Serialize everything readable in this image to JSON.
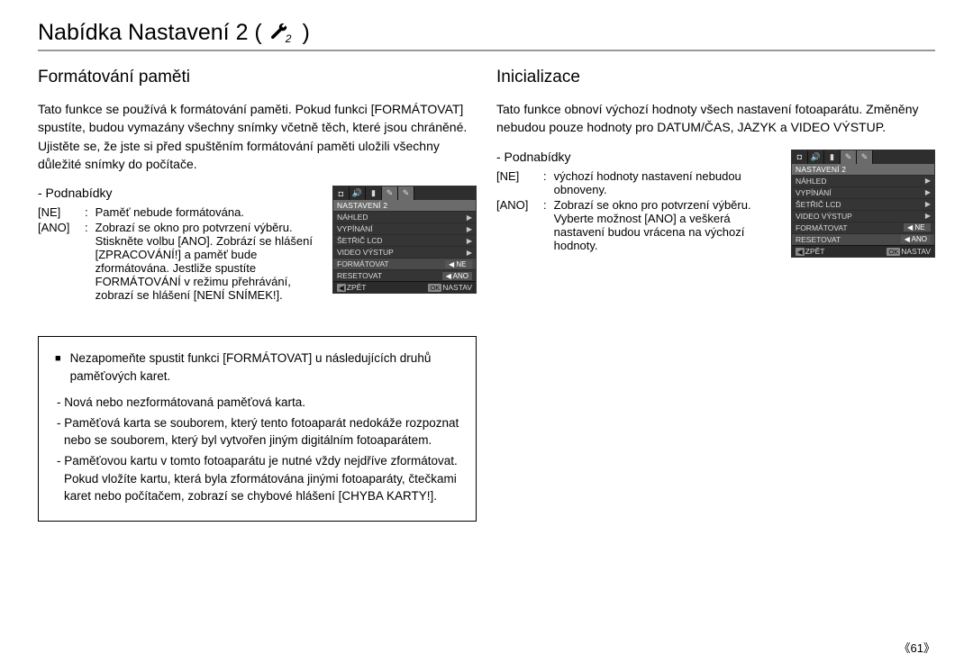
{
  "title_prefix": "Nabídka Nastavení 2 (",
  "title_suffix": ")",
  "col_left": {
    "heading": "Formátování paměti",
    "intro": "Tato funkce se používá k formátování paměti. Pokud funkci [FORMÁTOVAT] spustíte, budou vymazány všechny snímky včetně těch, které jsou chráněné. Ujistěte se, že jste si před spuštěním formátování paměti uložili všechny důležité snímky do počítače.",
    "sub_label": "- Podnabídky",
    "opts": [
      {
        "key": "[NE]",
        "sep": ":",
        "desc": "Paměť nebude formátována."
      },
      {
        "key": "[ANO]",
        "sep": ":",
        "desc": "Zobrazí se okno pro potvrzení výběru. Stiskněte volbu [ANO]. Zobrází se hlášení [ZPRACOVÁNÍ!] a paměť bude zformátována. Jestliže spustíte FORMÁTOVÁNÍ v režimu přehrávání, zobrazí se hlášení [NENÍ SNÍMEK!]."
      }
    ],
    "note_lead": "Nezapomeňte spustit funkci [FORMÁTOVAT] u následujících druhů paměťových karet.",
    "note_items": [
      "- Nová nebo nezformátovaná paměťová karta.",
      "- Paměťová karta se souborem, který tento fotoaparát nedokáže rozpoznat nebo se souborem, který byl vytvořen jiným digitálním fotoaparátem.",
      "- Paměťovou kartu v tomto fotoaparátu je nutné vždy nejdříve zformátovat. Pokud vložíte kartu, která byla zformátována jinými fotoaparáty, čtečkami karet nebo počítačem, zobrazí se chybové hlášení [CHYBA KARTY!]."
    ]
  },
  "col_right": {
    "heading": "Inicializace",
    "intro": "Tato funkce obnoví výchozí hodnoty všech nastavení fotoaparátu. Změněny nebudou pouze hodnoty pro DATUM/ČAS, JAZYK a VIDEO VÝSTUP.",
    "sub_label": "- Podnabídky",
    "opts": [
      {
        "key": "[NE]",
        "sep": ":",
        "desc": "výchozí hodnoty nastavení nebudou obnoveny."
      },
      {
        "key": "[ANO]",
        "sep": ":",
        "desc": "Zobrazí se okno pro potvrzení výběru. Vyberte možnost [ANO] a veškerá nastavení budou vrácena na výchozí hodnoty."
      }
    ]
  },
  "menu_left": {
    "title": "NASTAVENÍ 2",
    "items": [
      {
        "label": "NÁHLED",
        "arrow": "▶"
      },
      {
        "label": "VYPÍNÁNÍ",
        "arrow": "▶"
      },
      {
        "label": "ŠETŘIČ LCD",
        "arrow": "▶"
      },
      {
        "label": "VIDEO VÝSTUP",
        "arrow": "▶"
      },
      {
        "label": "FORMÁTOVAT",
        "value": "NE",
        "arrow_left": "◀",
        "hl": true
      },
      {
        "label": "RESETOVAT",
        "value": "ANO",
        "arrow_left": "◀"
      }
    ],
    "footer_left": "ZPĚT",
    "footer_left_key": "◀",
    "footer_right": "NASTAV",
    "footer_right_key": "OK"
  },
  "menu_right": {
    "title": "NASTAVENÍ 2",
    "items": [
      {
        "label": "NÁHLED",
        "arrow": "▶"
      },
      {
        "label": "VYPÍNÁNÍ",
        "arrow": "▶"
      },
      {
        "label": "ŠETŘIČ LCD",
        "arrow": "▶"
      },
      {
        "label": "VIDEO VÝSTUP",
        "arrow": "▶"
      },
      {
        "label": "FORMÁTOVAT",
        "value": "NE",
        "arrow_left": "◀"
      },
      {
        "label": "RESETOVAT",
        "value": "ANO",
        "arrow_left": "◀",
        "hl": true
      }
    ],
    "footer_left": "ZPĚT",
    "footer_left_key": "◀",
    "footer_right": "NASTAV",
    "footer_right_key": "OK"
  },
  "page_number": "61"
}
